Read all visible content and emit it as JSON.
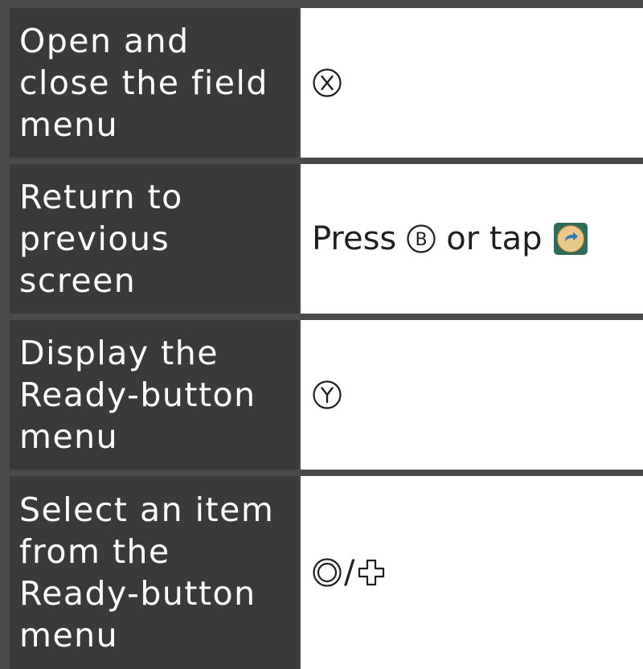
{
  "controls": [
    {
      "action": "Open and\nclose the field\nmenu",
      "input_icon": "x-button-icon"
    },
    {
      "action": "Return to\nprevious\nscreen",
      "press_text": "Press",
      "input_icon": "b-button-icon",
      "or_text": "or tap",
      "tap_icon": "back-arrow-touch-icon"
    },
    {
      "action": "Display the\nReady-button\nmenu",
      "input_icon": "y-button-icon"
    },
    {
      "action": "Select an item\nfrom the\nReady-button\nmenu",
      "input_icon": "circle-pad-icon",
      "separator": "/",
      "input_icon_2": "dpad-icon"
    }
  ],
  "colors": {
    "label_bg": "#3a3a3a",
    "label_text": "#ffffff",
    "value_bg": "#ffffff",
    "value_text": "#1f1f1f",
    "divider": "#4a4a4a"
  }
}
